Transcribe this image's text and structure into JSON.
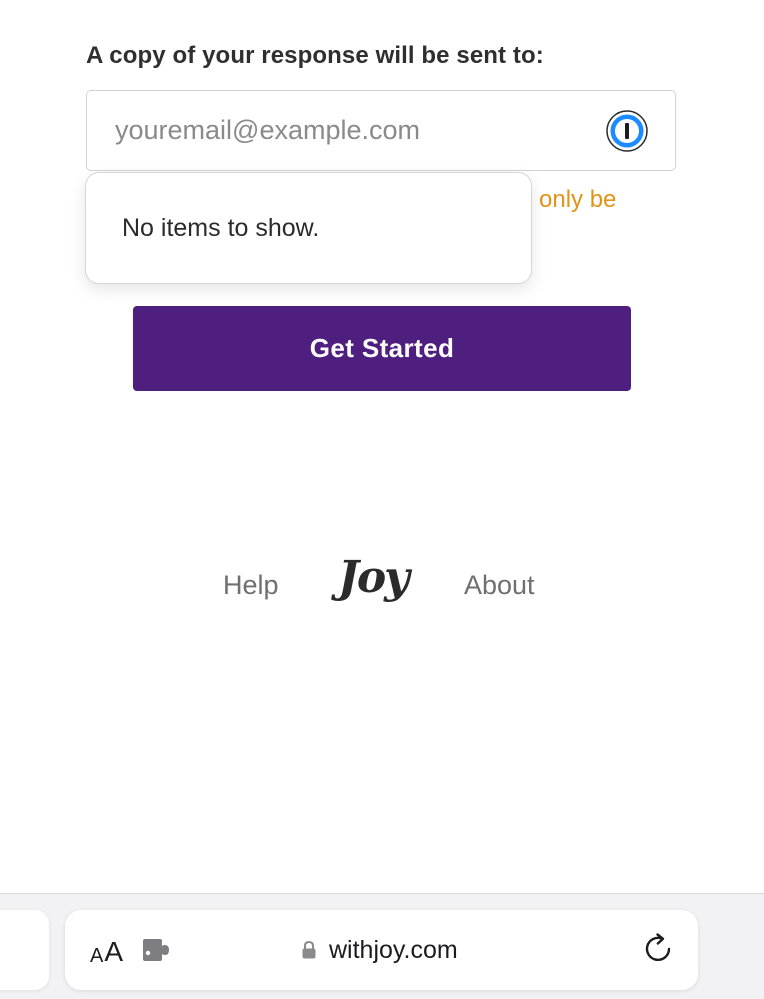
{
  "form": {
    "label": "A copy of your response will be sent to:",
    "email_value": "",
    "email_placeholder": "youremail@example.com",
    "helper_text": "only be"
  },
  "autofill": {
    "empty_message": "No items to show."
  },
  "cta": {
    "label": "Get Started"
  },
  "footer": {
    "help_label": "Help",
    "logo_text": "Joy",
    "about_label": "About"
  },
  "browser": {
    "aa_small": "A",
    "aa_large": "A",
    "url": "withjoy.com",
    "icons": {
      "password_manager": "1password-icon",
      "extension": "puzzle-piece-icon",
      "lock": "lock-icon",
      "reload": "reload-icon"
    }
  },
  "colors": {
    "brand_purple": "#4f1f7f",
    "helper_orange": "#e29419",
    "password_blue": "#1a8cff"
  }
}
